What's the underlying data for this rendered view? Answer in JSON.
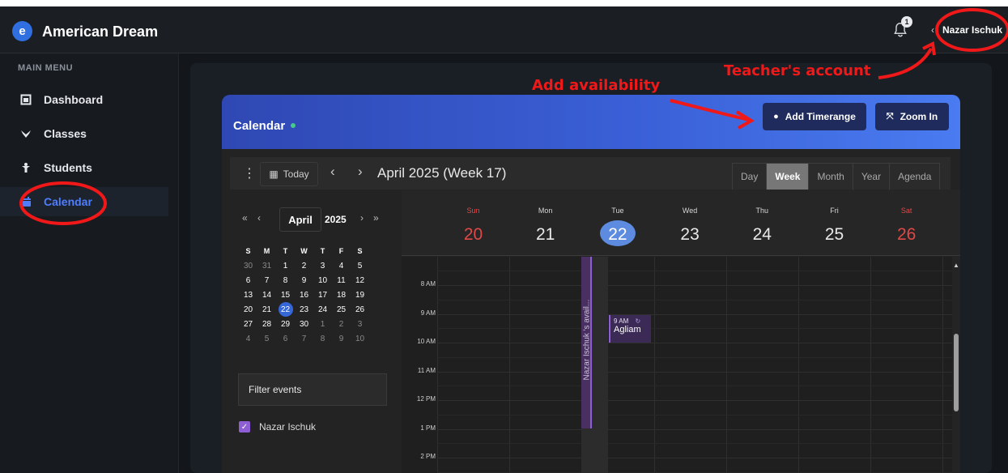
{
  "app": {
    "title": "American Dream",
    "logo_glyph": "e"
  },
  "header": {
    "notification_count": "1",
    "user_name": "Nazar Ischuk"
  },
  "sidebar": {
    "heading": "MAIN MENU",
    "items": [
      {
        "label": "Dashboard",
        "icon": "tablet-icon"
      },
      {
        "label": "Classes",
        "icon": "classes-icon"
      },
      {
        "label": "Students",
        "icon": "student-icon"
      },
      {
        "label": "Calendar",
        "icon": "calendar-icon",
        "active": true
      }
    ]
  },
  "card": {
    "title": "Calendar",
    "add_timerange": "Add Timerange",
    "zoom_in": "Zoom In"
  },
  "toolbar": {
    "today": "Today",
    "title": "April 2025 (Week 17)",
    "views": [
      "Day",
      "Week",
      "Month",
      "Year",
      "Agenda"
    ],
    "active_view": "Week"
  },
  "mini_calendar": {
    "month": "April",
    "year": "2025",
    "weekdays": [
      "S",
      "M",
      "T",
      "W",
      "T",
      "F",
      "S"
    ],
    "weeks": [
      [
        "30",
        "31",
        "1",
        "2",
        "3",
        "4",
        "5"
      ],
      [
        "6",
        "7",
        "8",
        "9",
        "10",
        "11",
        "12"
      ],
      [
        "13",
        "14",
        "15",
        "16",
        "17",
        "18",
        "19"
      ],
      [
        "20",
        "21",
        "22",
        "23",
        "24",
        "25",
        "26"
      ],
      [
        "27",
        "28",
        "29",
        "30",
        "1",
        "2",
        "3"
      ],
      [
        "4",
        "5",
        "6",
        "7",
        "8",
        "9",
        "10"
      ]
    ],
    "today": "22"
  },
  "filter": {
    "label": "Filter events"
  },
  "calendars": [
    {
      "name": "Nazar Ischuk",
      "checked": true,
      "color": "#8e5fd4"
    }
  ],
  "week": {
    "days": [
      {
        "dow": "Sun",
        "num": "20",
        "weekend": true
      },
      {
        "dow": "Mon",
        "num": "21"
      },
      {
        "dow": "Tue",
        "num": "22",
        "today": true
      },
      {
        "dow": "Wed",
        "num": "23"
      },
      {
        "dow": "Thu",
        "num": "24"
      },
      {
        "dow": "Fri",
        "num": "25"
      },
      {
        "dow": "Sat",
        "num": "26",
        "weekend": true
      }
    ],
    "hours": [
      "8 AM",
      "9 AM",
      "10 AM",
      "11 AM",
      "12 PM",
      "1 PM",
      "2 PM"
    ]
  },
  "availability": {
    "text": "Nazar Ischuk 's avail..."
  },
  "event": {
    "time": "9 AM",
    "title": "Agliam"
  },
  "annotations": {
    "add_availability": "Add availability",
    "teachers_account": "Teacher's account",
    "color": "#f01818"
  },
  "colors": {
    "accent": "#4f7dff",
    "event": "#8e5fd4",
    "weekend": "#e04848"
  }
}
